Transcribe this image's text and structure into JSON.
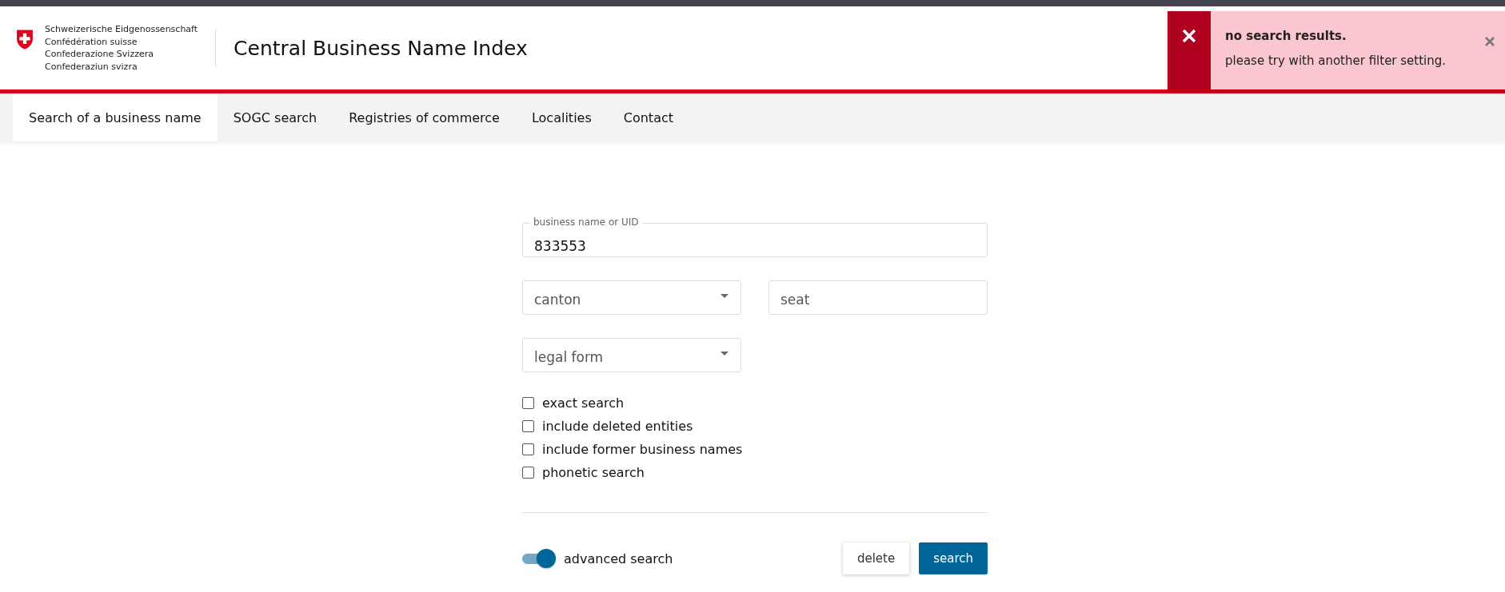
{
  "header": {
    "org_lines": [
      "Schweizerische Eidgenossenschaft",
      "Confédération suisse",
      "Confederazione Svizzera",
      "Confederaziun svizra"
    ],
    "title": "Central Business Name Index"
  },
  "toast": {
    "kind": "error",
    "title": "no search results.",
    "message": "please try with another filter setting."
  },
  "tabs": [
    {
      "label": "Search of a business name",
      "selected": true
    },
    {
      "label": "SOGC search",
      "selected": false
    },
    {
      "label": "Registries of commerce",
      "selected": false
    },
    {
      "label": "Localities",
      "selected": false
    },
    {
      "label": "Contact",
      "selected": false
    }
  ],
  "form": {
    "name_field": {
      "label": "business name or UID",
      "value": "833553"
    },
    "canton": {
      "placeholder": "canton"
    },
    "seat": {
      "placeholder": "seat"
    },
    "legal_form": {
      "placeholder": "legal form"
    },
    "options": [
      {
        "label": "exact search",
        "checked": false
      },
      {
        "label": "include deleted entities",
        "checked": false
      },
      {
        "label": "include former business names",
        "checked": false
      },
      {
        "label": "phonetic search",
        "checked": false
      }
    ],
    "advanced_search": {
      "label": "advanced search",
      "on": true
    },
    "buttons": [
      {
        "label": "delete",
        "kind": "secondary"
      },
      {
        "label": "search",
        "kind": "primary"
      }
    ]
  }
}
